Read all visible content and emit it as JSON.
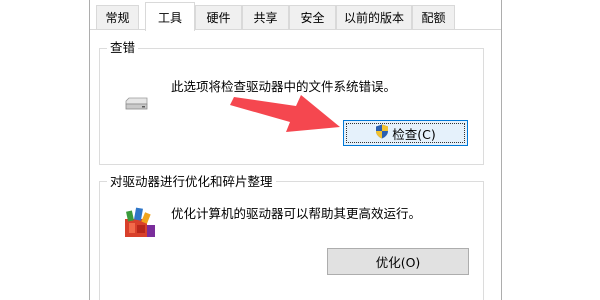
{
  "tabs": [
    {
      "label": "常规"
    },
    {
      "label": "工具",
      "active": true
    },
    {
      "label": "硬件"
    },
    {
      "label": "共享"
    },
    {
      "label": "安全"
    },
    {
      "label": "以前的版本"
    },
    {
      "label": "配额"
    }
  ],
  "error_check": {
    "title": "查错",
    "description": "此选项将检查驱动器中的文件系统错误。",
    "button_label": "检查(C)",
    "icon": "drive-icon",
    "button_icon": "uac-shield-icon"
  },
  "optimize": {
    "title": "对驱动器进行优化和碎片整理",
    "description": "优化计算机的驱动器可以帮助其更高效运行。",
    "button_label": "优化(O)",
    "icon": "defrag-icon"
  },
  "annotation": {
    "icon": "red-arrow-icon",
    "color": "#f5474f"
  }
}
